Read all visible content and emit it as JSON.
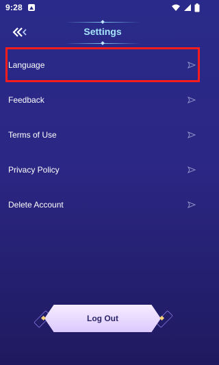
{
  "status_bar": {
    "time": "9:28"
  },
  "header": {
    "title": "Settings"
  },
  "menu": {
    "items": [
      {
        "label": "Language"
      },
      {
        "label": "Feedback"
      },
      {
        "label": "Terms of Use"
      },
      {
        "label": "Privacy Policy"
      },
      {
        "label": "Delete Account"
      }
    ]
  },
  "logout": {
    "label": "Log Out"
  },
  "colors": {
    "background_top": "#2a2a8a",
    "background_bottom": "#1f1a5f",
    "title": "#a6e6ff",
    "highlight": "#ff1c1c",
    "logout_bg": "#e9dcff",
    "logout_text": "#2c2668"
  },
  "icons": {
    "back": "double-chevron-left-icon",
    "arrow": "paper-plane-arrow-icon"
  }
}
